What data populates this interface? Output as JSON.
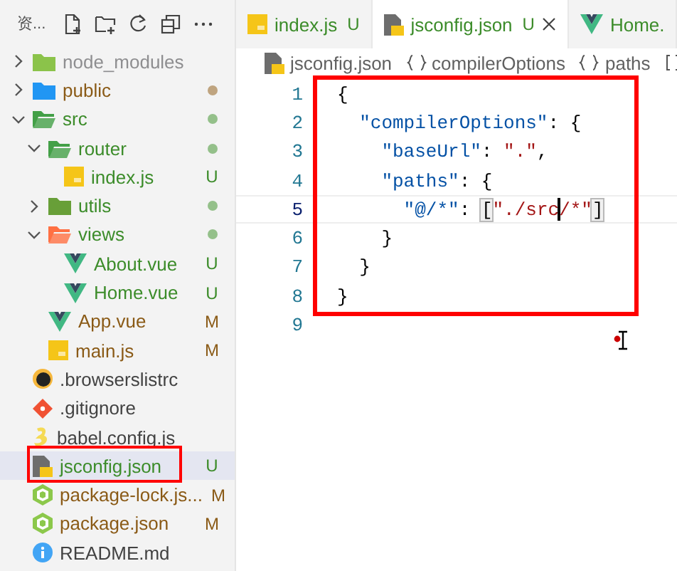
{
  "explorer": {
    "title": "资...",
    "tree": [
      {
        "kind": "nodefolder",
        "name": "node_modules",
        "color": "#8e8e90",
        "expanded": false,
        "selected": false,
        "highlighted": false,
        "dot": false
      },
      {
        "kind": "publicfolder",
        "name": "public",
        "color": "#8a5a16",
        "expanded": false,
        "selected": false,
        "highlighted": false,
        "dot": true
      },
      {
        "kind": "srcfolder",
        "name": "src",
        "color": "#3c8c2a",
        "expanded": true,
        "selected": false,
        "highlighted": false,
        "dot": true,
        "children": [
          {
            "kind": "routerfolder",
            "name": "router",
            "color": "#3c8c2a",
            "expanded": true,
            "selected": false,
            "highlighted": false,
            "dot": true,
            "children": [
              {
                "kind": "js",
                "name": "index.js",
                "color": "#3c8c2a",
                "selected": false,
                "highlighted": false,
                "badge": "U"
              }
            ]
          },
          {
            "kind": "utilsfolder",
            "name": "utils",
            "color": "#3c8c2a",
            "expanded": false,
            "selected": false,
            "highlighted": false,
            "dot": true
          },
          {
            "kind": "viewsfolder",
            "name": "views",
            "color": "#3c8c2a",
            "expanded": true,
            "selected": false,
            "highlighted": false,
            "dot": true,
            "children": [
              {
                "kind": "vue",
                "name": "About.vue",
                "color": "#3c8c2a",
                "selected": false,
                "highlighted": false,
                "badge": "U"
              },
              {
                "kind": "vue",
                "name": "Home.vue",
                "color": "#3c8c2a",
                "selected": false,
                "highlighted": false,
                "badge": "U"
              }
            ]
          },
          {
            "kind": "vue",
            "name": "App.vue",
            "color": "#8a5a16",
            "selected": false,
            "highlighted": false,
            "badge": "M"
          },
          {
            "kind": "js",
            "name": "main.js",
            "color": "#8a5a16",
            "selected": false,
            "highlighted": false,
            "badge": "M"
          }
        ]
      },
      {
        "kind": "browserslist",
        "name": ".browserslistrc",
        "color": "#424242",
        "selected": false,
        "highlighted": false
      },
      {
        "kind": "git",
        "name": ".gitignore",
        "color": "#424242",
        "selected": false,
        "highlighted": false
      },
      {
        "kind": "babel",
        "name": "babel.config.js",
        "color": "#424242",
        "selected": false,
        "highlighted": false
      },
      {
        "kind": "jsconfig",
        "name": "jsconfig.json",
        "color": "#3c8c2a",
        "selected": true,
        "highlighted": true,
        "badge": "U"
      },
      {
        "kind": "nodejson",
        "name": "package-lock.js...",
        "color": "#8a5a16",
        "selected": false,
        "highlighted": false,
        "badge": "M"
      },
      {
        "kind": "nodejson",
        "name": "package.json",
        "color": "#8a5a16",
        "selected": false,
        "highlighted": false,
        "badge": "M"
      },
      {
        "kind": "info",
        "name": "README.md",
        "color": "#424242",
        "selected": false,
        "highlighted": false
      }
    ]
  },
  "tabs": [
    {
      "kind": "js",
      "label": "index.js",
      "color": "#3c8c2a",
      "badge": "U",
      "selected": false
    },
    {
      "kind": "jsconfig",
      "label": "jsconfig.json",
      "color": "#3c8c2a",
      "badge": "U",
      "selected": true
    },
    {
      "kind": "vue",
      "label": "Home.",
      "color": "#3c8c2a",
      "selected": false
    }
  ],
  "breadcrumb": [
    {
      "kind": "file",
      "label": "jsconfig.json"
    },
    {
      "kind": "object",
      "label": "compilerOptions"
    },
    {
      "kind": "object",
      "label": "paths"
    },
    {
      "kind": "array"
    }
  ],
  "editor": {
    "highlight_box": true,
    "lines": [
      {
        "number": "1",
        "current": false,
        "tokens": [
          {
            "kind": "punct",
            "text": "{"
          }
        ]
      },
      {
        "number": "2",
        "current": false,
        "tokens": [
          {
            "kind": "key",
            "text": "  \"compilerOptions\""
          },
          {
            "kind": "punct",
            "text": ": {"
          }
        ]
      },
      {
        "number": "3",
        "current": false,
        "tokens": [
          {
            "kind": "key",
            "text": "    \"baseUrl\""
          },
          {
            "kind": "punct",
            "text": ": "
          },
          {
            "kind": "string",
            "text": "\".\""
          },
          {
            "kind": "punct",
            "text": ","
          }
        ]
      },
      {
        "number": "4",
        "current": false,
        "tokens": [
          {
            "kind": "key",
            "text": "    \"paths\""
          },
          {
            "kind": "punct",
            "text": ": {"
          }
        ]
      },
      {
        "number": "5",
        "current": true,
        "tokens": [
          {
            "kind": "key",
            "text": "      \"@/*\""
          },
          {
            "kind": "punct",
            "text": ": "
          },
          {
            "kind": "bracket",
            "text": "["
          },
          {
            "kind": "string",
            "text": "\"./src"
          },
          {
            "kind": "cursor"
          },
          {
            "kind": "string",
            "text": "/*\""
          },
          {
            "kind": "bracket",
            "text": "]"
          }
        ]
      },
      {
        "number": "6",
        "current": false,
        "tokens": [
          {
            "kind": "punct",
            "text": "    }"
          }
        ]
      },
      {
        "number": "7",
        "current": false,
        "tokens": [
          {
            "kind": "punct",
            "text": "  }"
          }
        ]
      },
      {
        "number": "8",
        "current": false,
        "tokens": [
          {
            "kind": "punct",
            "text": "}"
          }
        ]
      },
      {
        "number": "9",
        "current": false
      }
    ]
  }
}
